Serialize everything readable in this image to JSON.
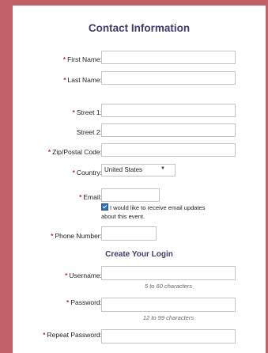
{
  "contact": {
    "title": "Contact Information",
    "required_marker": "*",
    "first_name_label": "First Name:",
    "last_name_label": "Last Name:",
    "street1_label": "Street 1:",
    "street2_label": "Street 2:",
    "zip_label": "Zip/Postal Code:",
    "country_label": "Country:",
    "country_value": "United States",
    "email_label": "Email:",
    "email_updates_text": "I would like to receive email updates about this event.",
    "email_updates_checked": true,
    "phone_label": "Phone Number:"
  },
  "login": {
    "title": "Create Your Login",
    "username_label": "Username:",
    "username_hint": "5 to 60 characters",
    "password_label": "Password:",
    "password_hint": "12 to 99 characters",
    "repeat_password_label": "Repeat Password:"
  },
  "colors": {
    "border": "#c15f67",
    "heading": "#3f3a6b",
    "required": "#c22b2b"
  }
}
